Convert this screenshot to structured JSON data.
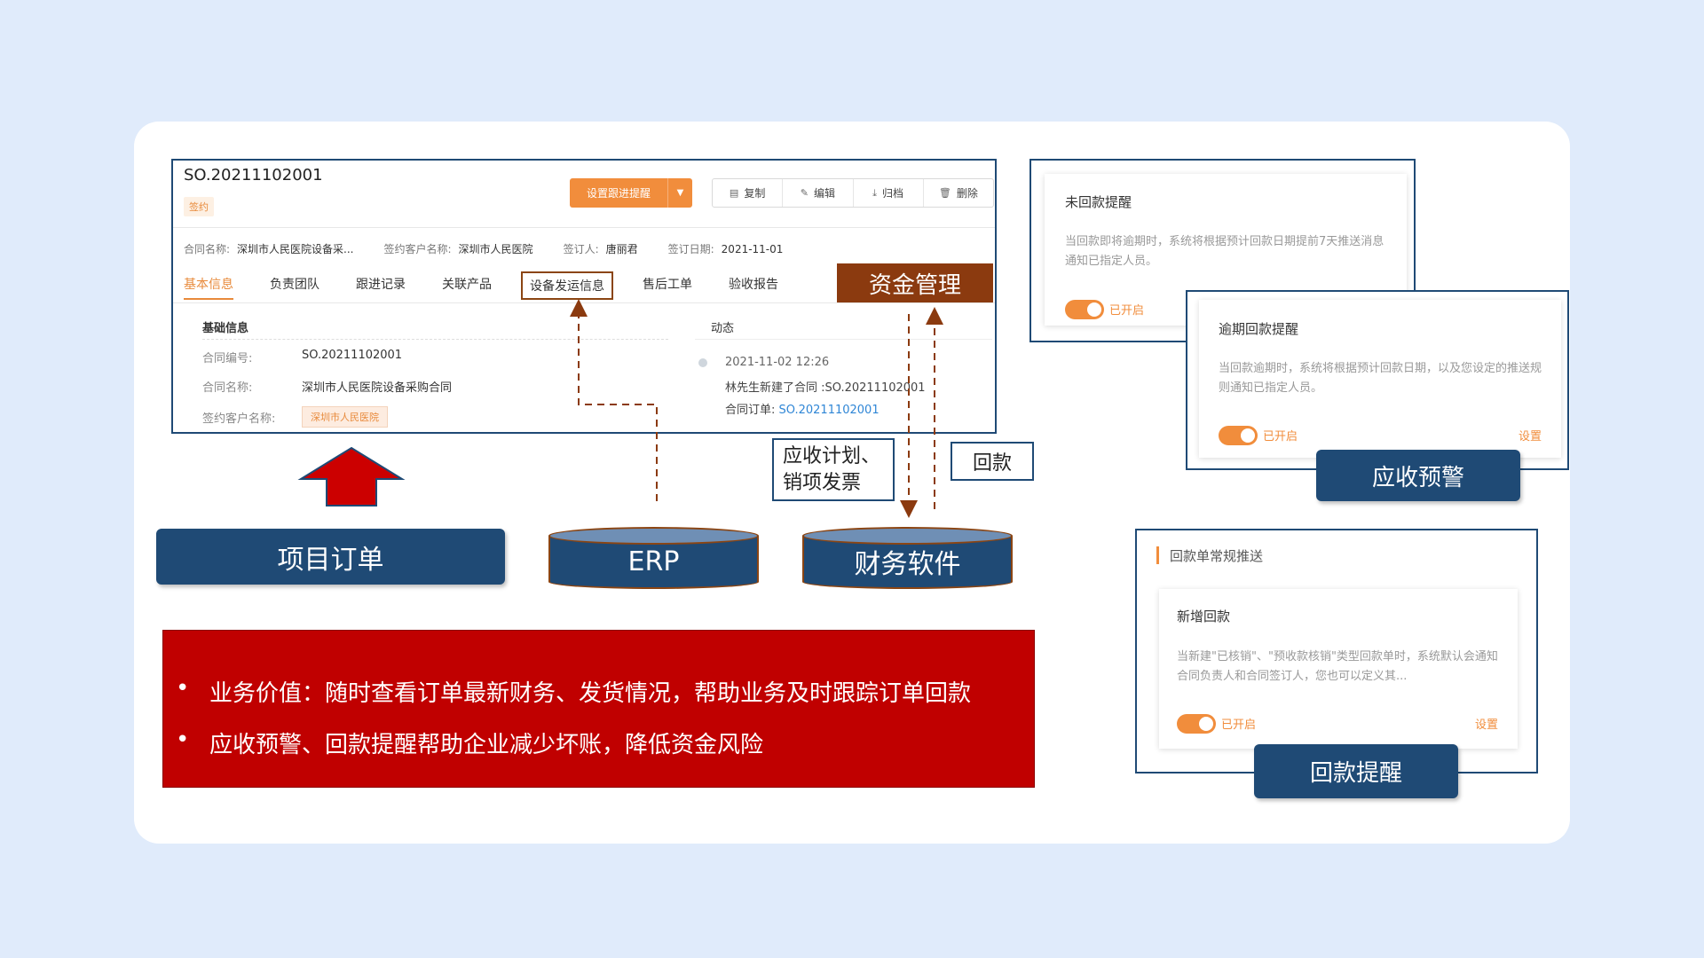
{
  "crm": {
    "order_id": "SO.20211102001",
    "status": "签约",
    "remind_button": "设置跟进提醒",
    "actions": {
      "copy": "复制",
      "edit": "编辑",
      "archive": "归档",
      "delete": "删除"
    },
    "info": {
      "contract_name_k": "合同名称:",
      "contract_name_v": "深圳市人民医院设备采...",
      "customer_k": "签约客户名称:",
      "customer_v": "深圳市人民医院",
      "signer_k": "签订人:",
      "signer_v": "唐丽君",
      "date_k": "签订日期:",
      "date_v": "2021-11-01"
    },
    "tabs": [
      "基本信息",
      "负责团队",
      "跟进记录",
      "关联产品",
      "设备发运信息",
      "售后工单",
      "验收报告"
    ],
    "money_tab": "资金管理",
    "basic": {
      "title": "基础信息",
      "no_k": "合同编号:",
      "no_v": "SO.20211102001",
      "name_k": "合同名称:",
      "name_v": "深圳市人民医院设备采购合同",
      "cust_k": "签约客户名称:",
      "cust_v": "深圳市人民医院"
    },
    "dynamic": {
      "title": "动态",
      "time": "2021-11-02 12:26",
      "text": "林先生新建了合同 :SO.20211102001",
      "order_k": "合同订单:",
      "order_v": "SO.20211102001"
    }
  },
  "labels": {
    "receivable_line1": "应收计划、",
    "receivable_line2": "销项发票",
    "payback": "回款",
    "project_order": "项目订单",
    "erp": "ERP",
    "finance": "财务软件"
  },
  "value_points": [
    "业务价值：随时查看订单最新财务、发货情况，帮助业务及时跟踪订单回款",
    "应收预警、回款提醒帮助企业减少坏账，降低资金风险"
  ],
  "alerts": {
    "unpaid": {
      "title": "未回款提醒",
      "desc": "当回款即将逾期时，系统将根据预计回款日期提前7天推送消息通知已指定人员。",
      "state": "已开启"
    },
    "overdue": {
      "title": "逾期回款提醒",
      "desc": "当回款逾期时，系统将根据预计回款日期，以及您设定的推送规则通知已指定人员。",
      "state": "已开启",
      "setting": "设置"
    },
    "warning_label": "应收预警",
    "routine_header": "回款单常规推送",
    "new_payment": {
      "title": "新增回款",
      "desc": "当新建\"已核销\"、\"预收款核销\"类型回款单时，系统默认会通知合同负责人和合同签订人，您也可以定义其...",
      "state": "已开启",
      "setting": "设置"
    },
    "reminder_label": "回款提醒"
  },
  "colors": {
    "navy": "#1f4a75",
    "orange": "#f18d3c",
    "red": "#c00000",
    "brown": "#8b3a0f"
  }
}
